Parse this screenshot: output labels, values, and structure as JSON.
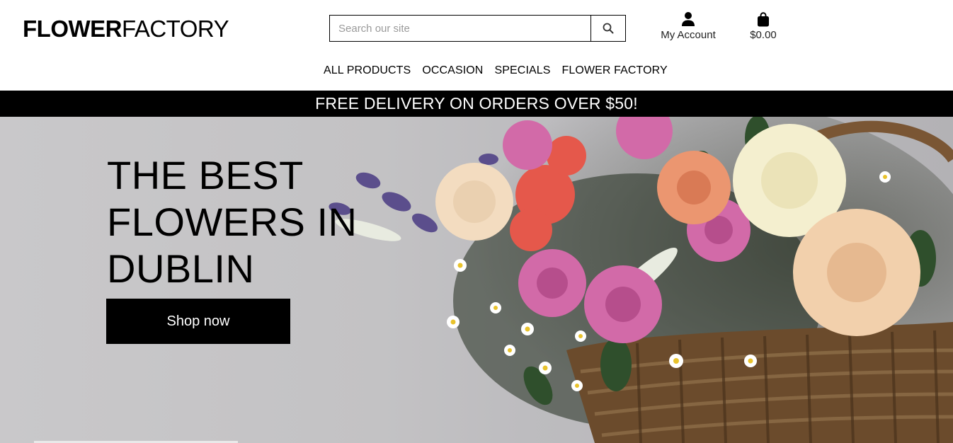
{
  "logo": {
    "bold": "FLOWER",
    "light": "FACTORY"
  },
  "search": {
    "placeholder": "Search our site",
    "icon": "magnifier-icon"
  },
  "account": {
    "label": "My Account",
    "icon": "user-icon"
  },
  "cart": {
    "label": "$0.00",
    "icon": "shopping-bag-icon"
  },
  "nav": {
    "items": [
      {
        "label": "ALL PRODUCTS"
      },
      {
        "label": "OCCASION"
      },
      {
        "label": "SPECIALS"
      },
      {
        "label": "FLOWER FACTORY"
      }
    ]
  },
  "banner": {
    "text": "FREE DELIVERY ON ORDERS OVER $50!"
  },
  "hero": {
    "title": "THE BEST FLOWERS IN DUBLIN",
    "button_label": "Shop now"
  },
  "colors": {
    "primary": "#000000",
    "background": "#ffffff",
    "banner_text": "#ffffff"
  }
}
